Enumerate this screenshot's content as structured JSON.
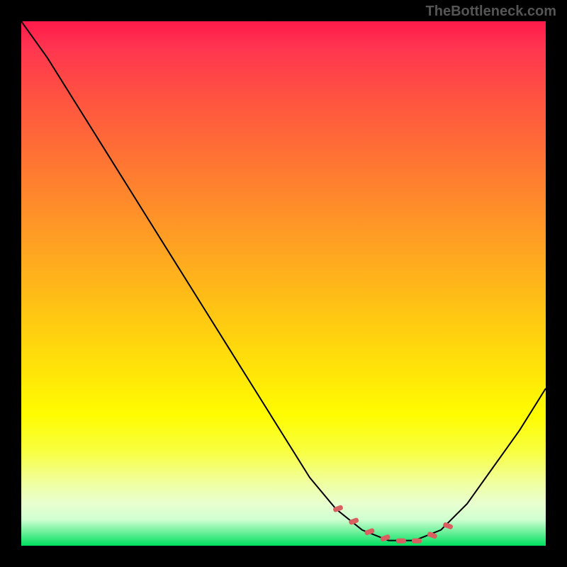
{
  "watermark": "TheBottleneck.com",
  "chart_data": {
    "type": "line",
    "title": "",
    "xlabel": "",
    "ylabel": "",
    "x_range": [
      0,
      100
    ],
    "y_range": [
      0,
      100
    ],
    "curve_points": [
      {
        "x": 0,
        "y": 100
      },
      {
        "x": 5,
        "y": 93
      },
      {
        "x": 10,
        "y": 85
      },
      {
        "x": 15,
        "y": 77
      },
      {
        "x": 20,
        "y": 69
      },
      {
        "x": 25,
        "y": 61
      },
      {
        "x": 30,
        "y": 53
      },
      {
        "x": 35,
        "y": 45
      },
      {
        "x": 40,
        "y": 37
      },
      {
        "x": 45,
        "y": 29
      },
      {
        "x": 50,
        "y": 21
      },
      {
        "x": 55,
        "y": 13
      },
      {
        "x": 60,
        "y": 7
      },
      {
        "x": 65,
        "y": 3
      },
      {
        "x": 70,
        "y": 1
      },
      {
        "x": 75,
        "y": 1
      },
      {
        "x": 80,
        "y": 3
      },
      {
        "x": 85,
        "y": 8
      },
      {
        "x": 90,
        "y": 15
      },
      {
        "x": 95,
        "y": 22
      },
      {
        "x": 100,
        "y": 30
      }
    ],
    "minimum_region": {
      "x_start": 60,
      "x_end": 82,
      "marker_color": "#d86060"
    },
    "gradient_stops": [
      {
        "pos": 0,
        "color": "#ff1a4a"
      },
      {
        "pos": 50,
        "color": "#ffc020"
      },
      {
        "pos": 85,
        "color": "#ffff60"
      },
      {
        "pos": 100,
        "color": "#00e060"
      }
    ]
  }
}
